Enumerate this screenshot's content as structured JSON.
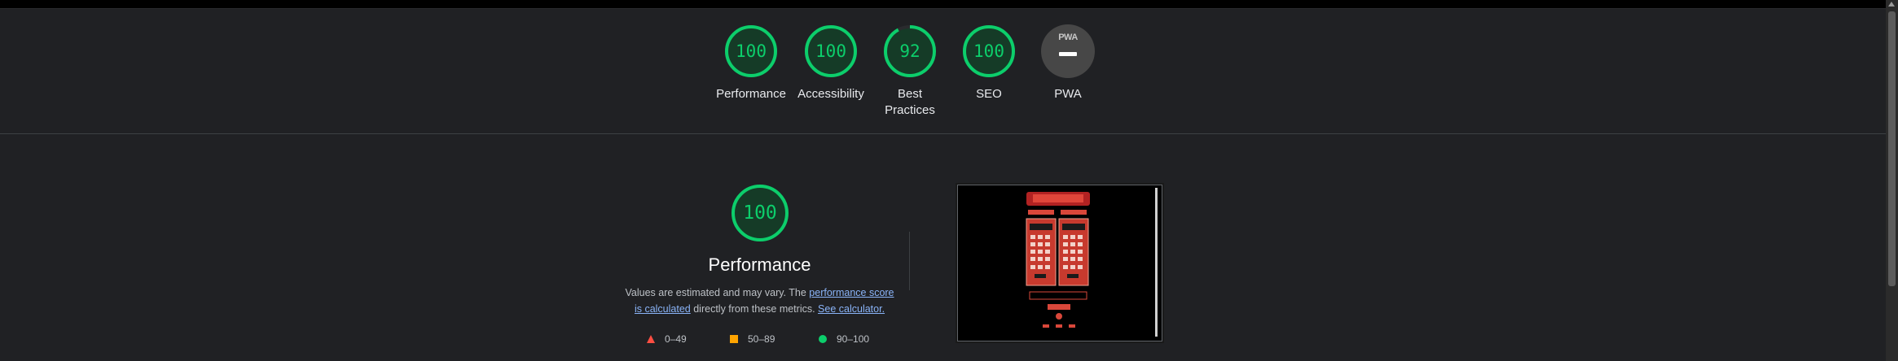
{
  "summary": {
    "gauges": [
      {
        "label": "Performance",
        "value": "100",
        "score": 100
      },
      {
        "label": "Accessibility",
        "value": "100",
        "score": 100
      },
      {
        "label": "Best Practices",
        "value": "92",
        "score": 92
      },
      {
        "label": "SEO",
        "value": "100",
        "score": 100
      }
    ],
    "pwa": {
      "label": "PWA",
      "badge_text": "PWA"
    }
  },
  "category": {
    "score": "100",
    "score_value": 100,
    "title": "Performance",
    "description_prefix": "Values are estimated and may vary. The ",
    "description_link": "performance score is calculated",
    "description_mid": " directly from these metrics. ",
    "calculator_link": "See calculator.",
    "legend": [
      {
        "range": "0–49",
        "shape": "triangle",
        "color": "#ff4e42"
      },
      {
        "range": "50–89",
        "shape": "square",
        "color": "#ffa400"
      },
      {
        "range": "90–100",
        "shape": "circle",
        "color": "#0cce6b"
      }
    ]
  },
  "colors": {
    "pass": "#0cce6b",
    "background": "#202124"
  }
}
